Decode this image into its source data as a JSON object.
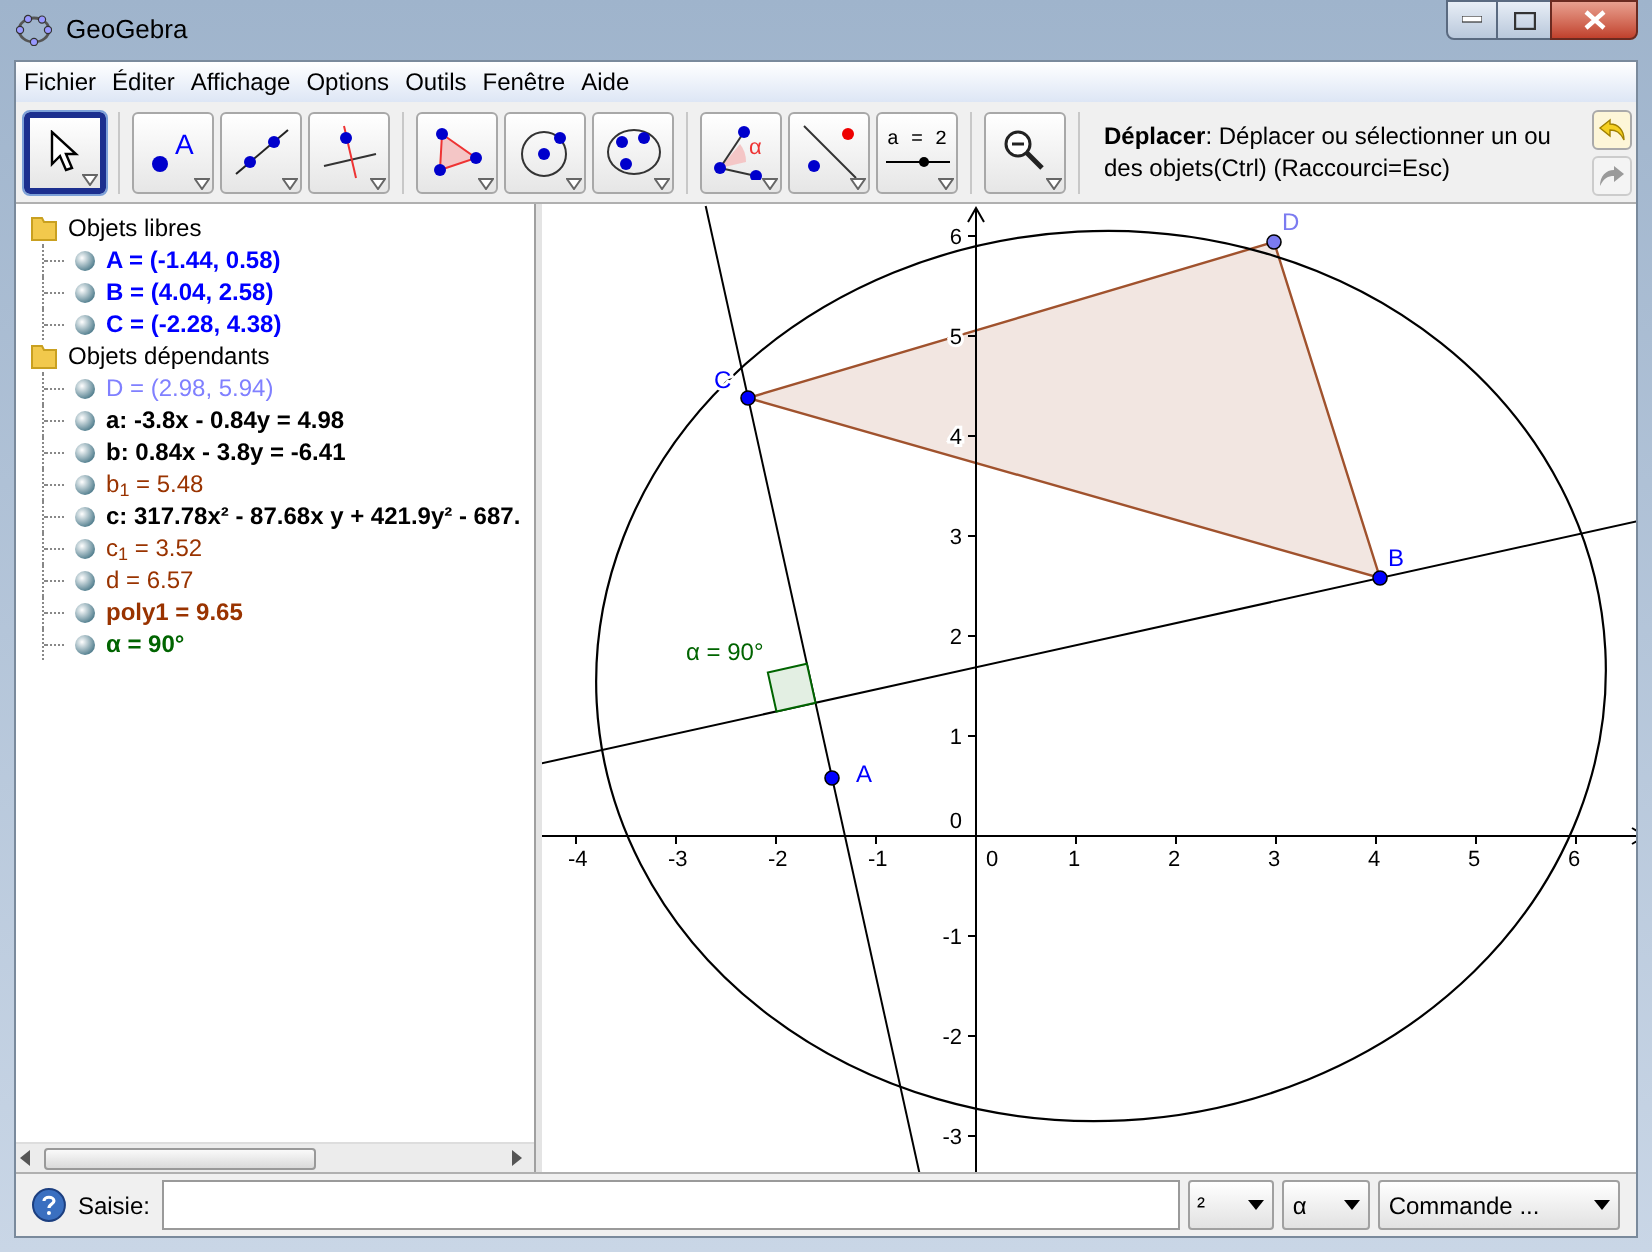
{
  "window": {
    "title": "GeoGebra"
  },
  "menu": [
    "Fichier",
    "Éditer",
    "Affichage",
    "Options",
    "Outils",
    "Fenêtre",
    "Aide"
  ],
  "toolbar": {
    "tools": [
      {
        "kind": "move",
        "selected": true
      },
      {
        "kind": "point",
        "selected": false,
        "label": "A"
      },
      {
        "kind": "line",
        "selected": false
      },
      {
        "kind": "perpendicular",
        "selected": false
      },
      {
        "kind": "polygon",
        "selected": false
      },
      {
        "kind": "circle",
        "selected": false
      },
      {
        "kind": "conic",
        "selected": false
      },
      {
        "kind": "angle",
        "selected": false,
        "label": "α"
      },
      {
        "kind": "reflect",
        "selected": false
      },
      {
        "kind": "slider",
        "selected": false,
        "label": "a = 2"
      },
      {
        "kind": "zoom",
        "selected": false
      }
    ],
    "help": "**Déplacer**: Déplacer ou sélectionner un ou des objets(Ctrl) (Raccourci=Esc)"
  },
  "algebra": {
    "folders": [
      {
        "label": "Objets libres",
        "children": [
          {
            "text": "A = (-1.44, 0.58)",
            "color": "#0000ff",
            "bold": true
          },
          {
            "text": "B = (4.04, 2.58)",
            "color": "#0000ff",
            "bold": true
          },
          {
            "text": "C = (-2.28, 4.38)",
            "color": "#0000ff",
            "bold": true
          }
        ]
      },
      {
        "label": "Objets dépendants",
        "children": [
          {
            "text": "D = (2.98, 5.94)",
            "color": "#8080ff",
            "bold": false
          },
          {
            "text": "a: -3.8x - 0.84y = 4.98",
            "color": "#000000",
            "bold": true
          },
          {
            "text": "b: 0.84x - 3.8y = -6.41",
            "color": "#000000",
            "bold": true
          },
          {
            "text": "b$_{1}$ = 5.48",
            "color": "#993300",
            "bold": false
          },
          {
            "text": "c: 317.78x² - 87.68x y + 421.9y² - 687.",
            "color": "#000000",
            "bold": true
          },
          {
            "text": "c$_{1}$ = 3.52",
            "color": "#993300",
            "bold": false
          },
          {
            "text": "d = 6.57",
            "color": "#993300",
            "bold": false
          },
          {
            "text": "poly1 = 9.65",
            "color": "#993300",
            "bold": true
          },
          {
            "text": "α = 90°",
            "color": "#006400",
            "bold": true
          }
        ]
      }
    ]
  },
  "graphics": {
    "points": [
      {
        "label": "A",
        "color": "#0000ff"
      },
      {
        "label": "B",
        "color": "#0000ff"
      },
      {
        "label": "C",
        "color": "#0000ff"
      },
      {
        "label": "D",
        "color": "#7b7bf0"
      }
    ],
    "angle_label": "α = 90°",
    "x_ticks": [
      "-4",
      "-3",
      "-2",
      "-1",
      "0",
      "1",
      "2",
      "3",
      "4",
      "5",
      "6"
    ],
    "y_ticks": [
      "6",
      "5",
      "4",
      "3",
      "2",
      "1",
      "0",
      "-1",
      "-2",
      "-3"
    ]
  },
  "input_bar": {
    "label": "Saisie:",
    "dropdowns": [
      "²",
      "α",
      "Commande ..."
    ]
  }
}
